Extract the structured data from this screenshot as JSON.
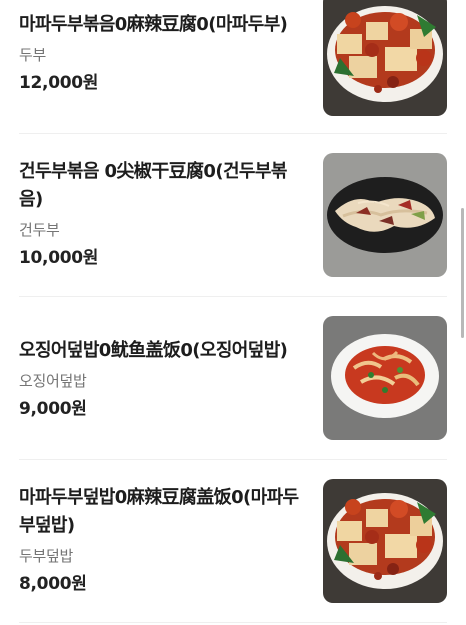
{
  "menu": {
    "items": [
      {
        "name": "마파두부볶음0麻辣豆腐0(마파두부)",
        "description": "두부",
        "price": "12,000원",
        "image_icon": "mapo-tofu-food-photo"
      },
      {
        "name": "건두부볶음 0尖椒干豆腐0(건두부볶음)",
        "description": "건두부",
        "price": "10,000원",
        "image_icon": "dried-tofu-stir-fry-photo"
      },
      {
        "name": "오징어덮밥0鱿鱼盖饭0(오징어덮밥)",
        "description": "오징어덮밥",
        "price": "9,000원",
        "image_icon": "squid-rice-bowl-photo"
      },
      {
        "name": "마파두부덮밥0麻辣豆腐盖饭0(마파두부덮밥)",
        "description": "두부덮밥",
        "price": "8,000원",
        "image_icon": "mapo-tofu-rice-photo"
      }
    ]
  },
  "colors": {
    "title": "#1d1d1d",
    "description": "#757575",
    "price": "#222222",
    "divider": "#efefef",
    "scrollbar": "#b8b8b8"
  }
}
